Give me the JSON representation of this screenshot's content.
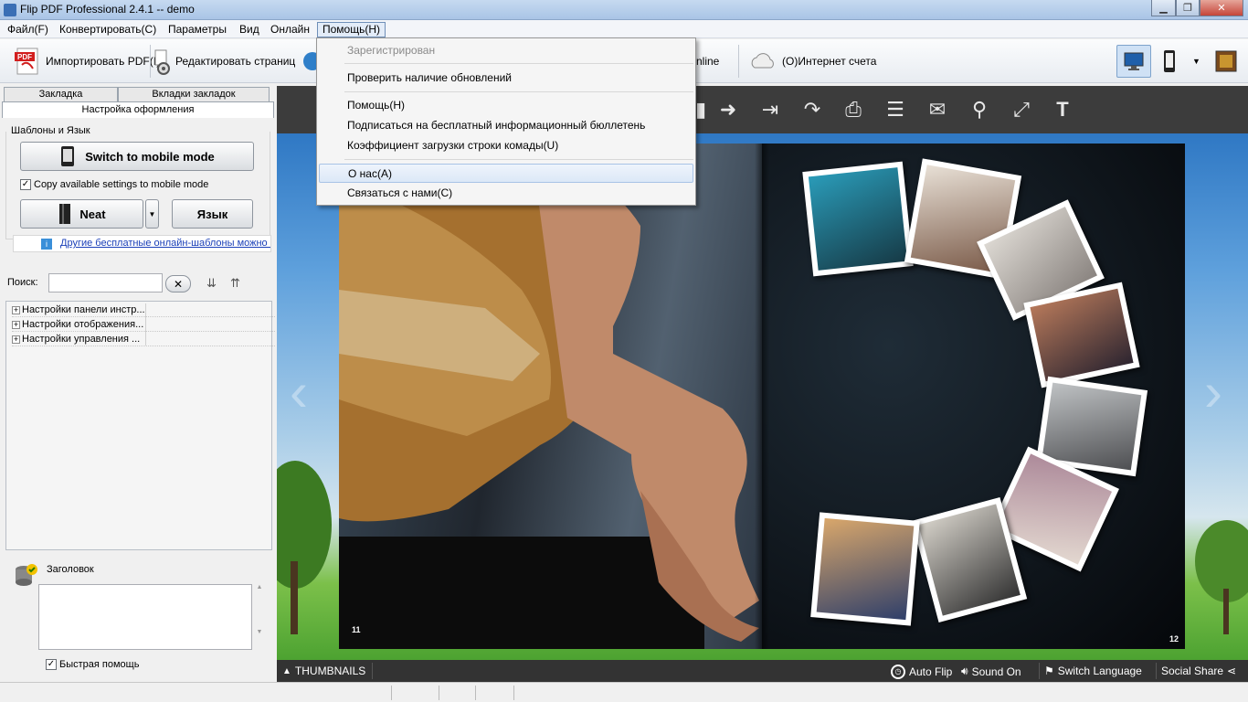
{
  "window": {
    "title": "Flip PDF Professional 2.4.1  -- demo"
  },
  "menubar": {
    "items": [
      "Файл(F)",
      "Конвертировать(C)",
      "Параметры",
      "Вид",
      "Онлайн",
      "Помощь(H)"
    ]
  },
  "toolbar": {
    "import_label": "Импортировать PDF(I)",
    "edit_pages_label": "Редактировать страниц",
    "online_label": "nline",
    "account_label": "(O)Интернет счета"
  },
  "help_menu": {
    "registered": "Зарегистрирован",
    "check_updates": "Проверить наличие обновлений",
    "help": "Помощь(H)",
    "newsletter": "Подписаться на бесплатный информационный бюллетень",
    "load_factor": "Коэффициент загрузки строки комады(U)",
    "about": "О нас(A)",
    "contact": "Связаться с нами(C)"
  },
  "left_panel": {
    "tab_bookmark": "Закладка",
    "tab_bookmark_tabs": "Вкладки закладок",
    "design_settings": "Настройка оформления",
    "templates_group": "Шаблоны и Язык",
    "mobile_button": "Switch to mobile mode",
    "copy_settings_label": "Copy available settings to mobile mode",
    "copy_settings_checked": true,
    "template_button": "Neat",
    "language_button": "Язык",
    "free_templates_link": "Другие бесплатные онлайн-шаблоны можно н",
    "search_label": "Поиск:",
    "search_value": "",
    "tree": [
      "Настройки панели инстр...",
      "Настройки отображения...",
      "Настройки управления ..."
    ],
    "caption_label": "Заголовок",
    "caption_value": "",
    "quick_help_label": "Быстрая помощь",
    "quick_help_checked": true
  },
  "viewer": {
    "page_left": "11",
    "page_right": "12",
    "thumbnails": "THUMBNAILS",
    "auto_flip": "Auto Flip",
    "sound": "Sound On",
    "switch_language": "Switch Language",
    "social_share": "Social Share"
  },
  "colors": {
    "menu_highlight": "#dce8f7",
    "viewer_bar": "#3c3c3c",
    "sky": "#5ea0dc",
    "grass": "#3f9a2a"
  }
}
